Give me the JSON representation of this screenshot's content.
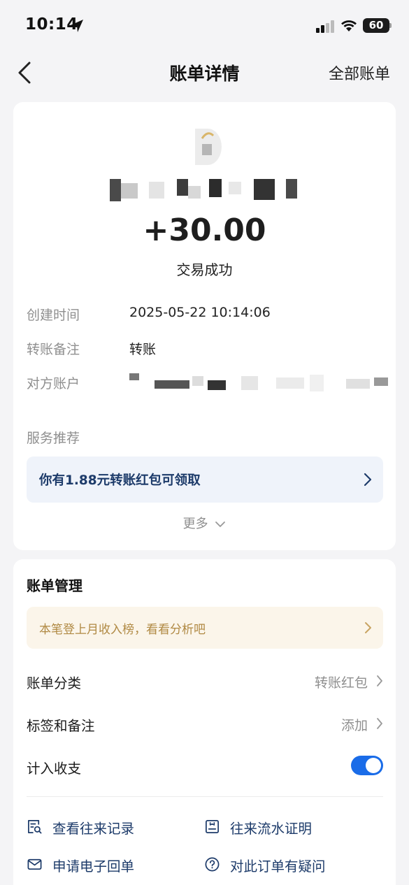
{
  "status_bar": {
    "time": "10:14",
    "battery": "60"
  },
  "nav": {
    "title": "账单详情",
    "right_link": "全部账单"
  },
  "transaction": {
    "amount": "+30.00",
    "status": "交易成功",
    "details": [
      {
        "label": "创建时间",
        "value": "2025-05-22 10:14:06"
      },
      {
        "label": "转账备注",
        "value": "转账"
      },
      {
        "label": "对方账户",
        "value": ""
      }
    ]
  },
  "service": {
    "section_label": "服务推荐",
    "promo_text": "你有1.88元转账红包可领取",
    "more_label": "更多"
  },
  "management": {
    "title": "账单管理",
    "ranking_text": "本笔登上月收入榜，看看分析吧",
    "rows": [
      {
        "label": "账单分类",
        "value": "转账红包"
      },
      {
        "label": "标签和备注",
        "value": "添加"
      },
      {
        "label": "计入收支",
        "value": ""
      }
    ],
    "include_in_stats": true
  },
  "actions": [
    {
      "label": "查看往来记录",
      "icon": "search-record-icon"
    },
    {
      "label": "往来流水证明",
      "icon": "statement-icon"
    },
    {
      "label": "申请电子回单",
      "icon": "mail-icon"
    },
    {
      "label": "对此订单有疑问",
      "icon": "question-icon"
    }
  ],
  "colors": {
    "accent": "#1a6ce8",
    "link_blue": "#1d3b6a",
    "gold": "#b08943"
  }
}
